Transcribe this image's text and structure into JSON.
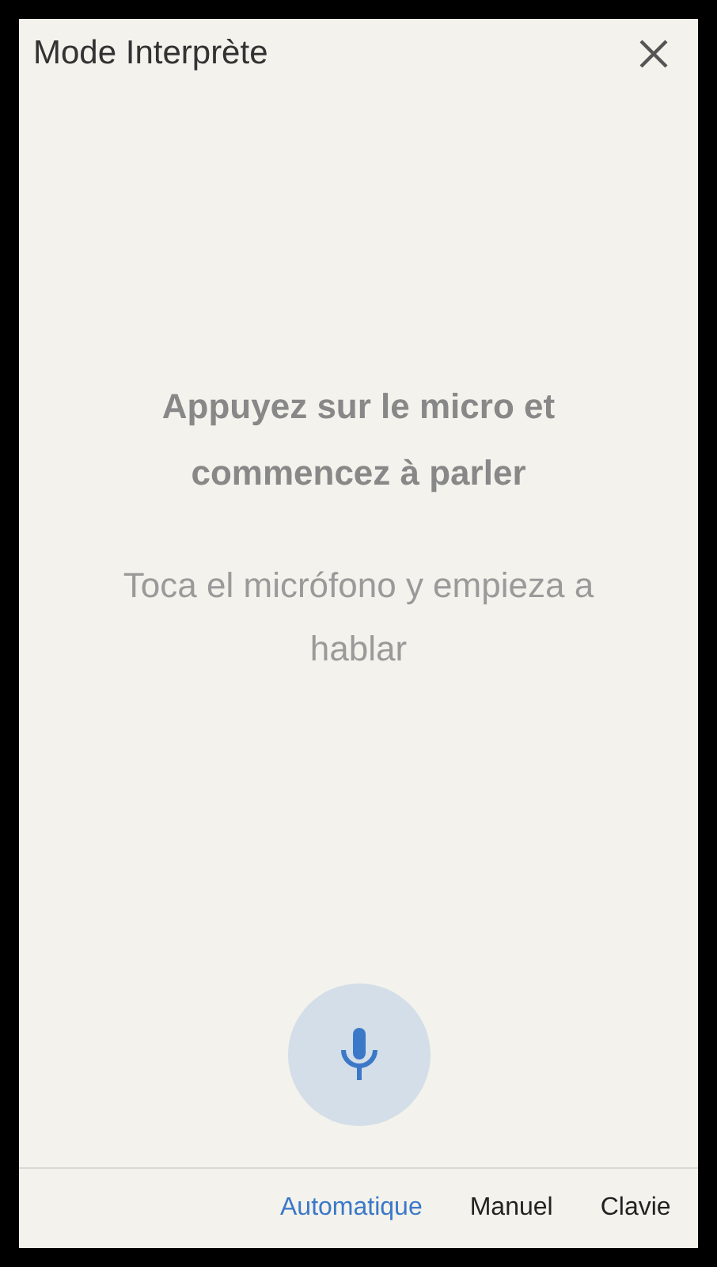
{
  "header": {
    "title": "Mode Interprète"
  },
  "prompts": [
    {
      "kind": "source",
      "text": "Appuyez sur le micro et commencez à parler"
    },
    {
      "kind": "target",
      "text": "Toca el micrófono y empieza a hablar"
    }
  ],
  "mic": {
    "active": false
  },
  "tabs": [
    {
      "label": "Automatique",
      "selected": true
    },
    {
      "label": "Manuel",
      "selected": false
    },
    {
      "label": "Clavie",
      "selected": false
    }
  ]
}
